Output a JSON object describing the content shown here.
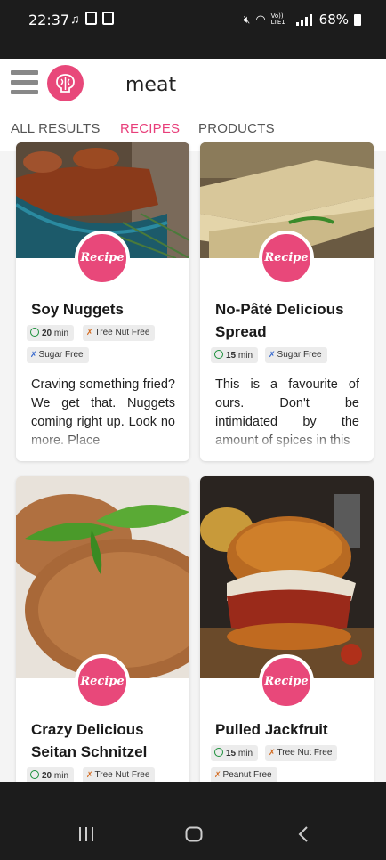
{
  "status_bar": {
    "time": "22:37",
    "battery": "68%",
    "network_label": "Vo)) LTE1"
  },
  "header": {
    "search_query": "meat"
  },
  "tabs": [
    {
      "label": "ALL RESULTS",
      "active": false
    },
    {
      "label": "RECIPES",
      "active": true
    },
    {
      "label": "PRODUCTS",
      "active": false
    }
  ],
  "accent_color": "#e83e7a",
  "recipe_badge_label": "Recipe",
  "cards": [
    {
      "title_line1": "Soy Nuggets",
      "title_line2": "",
      "time": "20",
      "time_unit": "min",
      "tags": [
        "Tree Nut Free",
        "Sugar Free"
      ],
      "description": "Craving something fried? We get that. Nuggets coming right up. Look no more. Place"
    },
    {
      "title_line1": "No-Pâté Delicious",
      "title_line2": "Spread",
      "time": "15",
      "time_unit": "min",
      "tags": [
        "Sugar Free"
      ],
      "description": "This is a favourite of ours. Don't be intimidated by the amount of spices in this"
    },
    {
      "title_line1": "Crazy Delicious",
      "title_line2": "Seitan Schnitzel",
      "time": "20",
      "time_unit": "min",
      "tags": [
        "Tree Nut Free"
      ],
      "description": ""
    },
    {
      "title_line1": "Pulled Jackfruit",
      "title_line2": "",
      "time": "15",
      "time_unit": "min",
      "tags": [
        "Tree Nut Free",
        "Peanut Free"
      ],
      "description": ""
    }
  ]
}
